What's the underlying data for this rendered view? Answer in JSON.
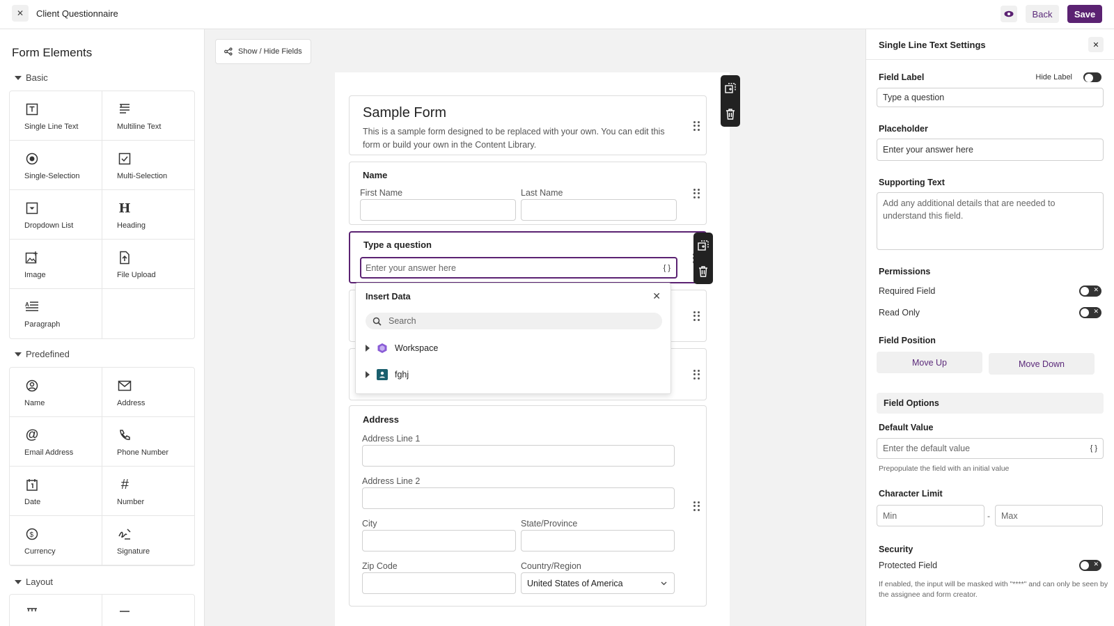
{
  "topbar": {
    "title": "Client Questionnaire",
    "back_label": "Back",
    "save_label": "Save",
    "accent": "#5b2272"
  },
  "sidebar": {
    "title": "Form Elements",
    "sections": {
      "basic": "Basic",
      "predefined": "Predefined",
      "layout": "Layout"
    },
    "basic": [
      {
        "label": "Single Line Text",
        "icon": "text-box-icon"
      },
      {
        "label": "Multiline Text",
        "icon": "multiline-icon"
      },
      {
        "label": "Single-Selection",
        "icon": "radio-icon"
      },
      {
        "label": "Multi-Selection",
        "icon": "checkbox-icon"
      },
      {
        "label": "Dropdown List",
        "icon": "dropdown-icon"
      },
      {
        "label": "Heading",
        "icon": "heading-icon"
      },
      {
        "label": "Image",
        "icon": "image-icon"
      },
      {
        "label": "File Upload",
        "icon": "file-upload-icon"
      },
      {
        "label": "Paragraph",
        "icon": "paragraph-icon"
      }
    ],
    "predefined": [
      {
        "label": "Name",
        "icon": "person-icon"
      },
      {
        "label": "Address",
        "icon": "envelope-icon"
      },
      {
        "label": "Email Address",
        "icon": "at-icon"
      },
      {
        "label": "Phone Number",
        "icon": "phone-icon"
      },
      {
        "label": "Date",
        "icon": "calendar-icon"
      },
      {
        "label": "Number",
        "icon": "hash-icon"
      },
      {
        "label": "Currency",
        "icon": "currency-icon"
      },
      {
        "label": "Signature",
        "icon": "signature-icon"
      }
    ]
  },
  "canvas": {
    "show_hide_label": "Show / Hide Fields",
    "form_title": "Sample Form",
    "form_description": "This is a sample form designed to be replaced with your own. You can edit this form or build your own in the Content Library.",
    "name_card": {
      "heading": "Name",
      "first": "First Name",
      "last": "Last Name"
    },
    "question_card": {
      "heading": "Type a question",
      "placeholder": "Enter your answer here",
      "braces": "{ }"
    },
    "address_card": {
      "heading": "Address",
      "line1": "Address Line 1",
      "line2": "Address Line 2",
      "city": "City",
      "state": "State/Province",
      "zip": "Zip Code",
      "country": "Country/Region",
      "country_value": "United States of America"
    }
  },
  "insert_data": {
    "title": "Insert Data",
    "search_placeholder": "Search",
    "items": [
      {
        "label": "Workspace",
        "color": "#8a5cd6"
      },
      {
        "label": "fghj",
        "color": "#1a5f6e"
      }
    ]
  },
  "settings": {
    "title": "Single Line Text Settings",
    "field_label": "Field Label",
    "hide_label": "Hide Label",
    "field_label_value": "Type a question",
    "placeholder_label": "Placeholder",
    "placeholder_value": "Enter your answer here",
    "supporting_text": "Supporting Text",
    "supporting_placeholder": "Add any additional details that are needed to understand this field.",
    "permissions": "Permissions",
    "required_field": "Required Field",
    "read_only": "Read Only",
    "field_position": "Field Position",
    "move_up": "Move Up",
    "move_down": "Move Down",
    "field_options": "Field Options",
    "default_value": "Default Value",
    "default_placeholder": "Enter the default value",
    "default_help": "Prepopulate the field with an initial value",
    "braces": "{ }",
    "character_limit": "Character Limit",
    "min": "Min",
    "max": "Max",
    "dash": "-",
    "security": "Security",
    "protected_field": "Protected Field",
    "security_help": "If enabled, the input will be masked with \"****\" and can only be seen by the assignee and form creator."
  }
}
